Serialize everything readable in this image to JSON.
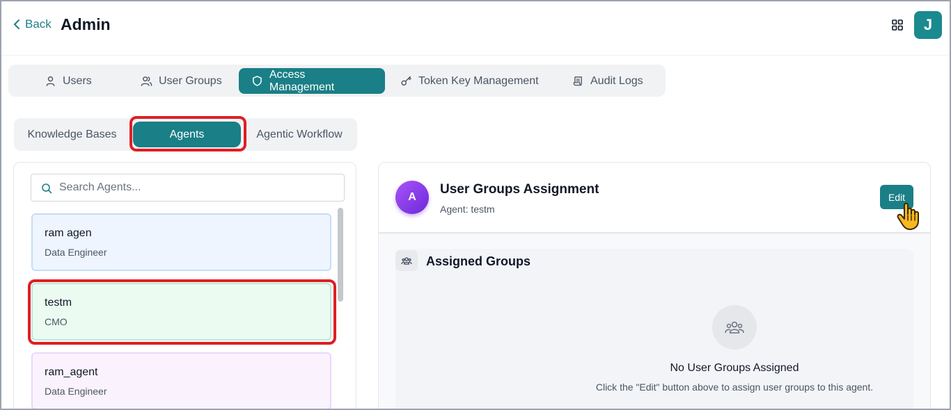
{
  "header": {
    "back_label": "Back",
    "title": "Admin",
    "user_initial": "J"
  },
  "main_tabs": [
    {
      "label": "Users",
      "icon": "user-icon",
      "active": false
    },
    {
      "label": "User Groups",
      "icon": "users-icon",
      "active": false
    },
    {
      "label": "Access Management",
      "icon": "shield-icon",
      "active": true
    },
    {
      "label": "Token Key Management",
      "icon": "key-icon",
      "active": false
    },
    {
      "label": "Audit Logs",
      "icon": "scroll-icon",
      "active": false
    }
  ],
  "sub_tabs": [
    {
      "label": "Knowledge Bases",
      "active": false
    },
    {
      "label": "Agents",
      "active": true
    },
    {
      "label": "Agentic Workflow",
      "active": false
    }
  ],
  "search": {
    "placeholder": "Search Agents..."
  },
  "agents": [
    {
      "name": "ram agen",
      "role": "Data Engineer",
      "color": "blue"
    },
    {
      "name": "testm",
      "role": "CMO",
      "color": "green",
      "selected": true
    },
    {
      "name": "ram_agent",
      "role": "Data Engineer",
      "color": "purple"
    }
  ],
  "detail": {
    "avatar_initial": "A",
    "title": "User Groups Assignment",
    "subtitle": "Agent: testm",
    "edit_label": "Edit",
    "section_title": "Assigned Groups",
    "empty_title": "No User Groups Assigned",
    "empty_desc": "Click the \"Edit\" button above to assign user groups to this agent."
  },
  "colors": {
    "accent": "#1a7f86",
    "highlight": "#e11d24"
  }
}
